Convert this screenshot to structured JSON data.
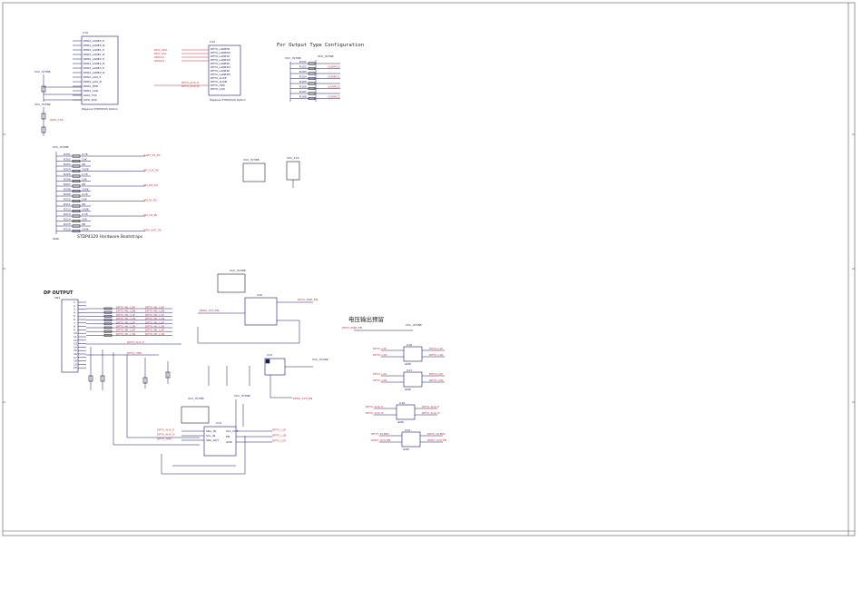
{
  "titles": {
    "config_heading": "For Output Type Configuration",
    "bootstraps": "STDP4320 Hardware Bootstraps",
    "dp_output": "DP   OUTPUT",
    "voltage_heading": "电压输出预留"
  },
  "parts": {
    "u_top_left": "Pegasus STDP4320 Option",
    "u_top_mid": "Pegasus STDP4320 Option",
    "u_dp_conn": "CN1",
    "u_ps": "U10",
    "u_sw": "U13",
    "u_ic1": "U16",
    "u_ic2": "U17",
    "u_ic3": "U18",
    "u_ic4": "U19"
  },
  "power": {
    "vcc33": "VCC_3V3SB",
    "gnd": "GND",
    "vcc12": "VCC_1V2"
  },
  "nets": {
    "left_pins": [
      "DPRX_LANE0_P",
      "DPRX_LANE0_N",
      "DPRX_LANE1_P",
      "DPRX_LANE1_N",
      "DPRX_LANE2_P",
      "DPRX_LANE2_N",
      "DPRX_LANE3_P",
      "DPRX_LANE3_N",
      "DPRX_AUX_P",
      "DPRX_AUX_N",
      "DPRX_HPD",
      "DPRX_CAD",
      "GPIO_TX0",
      "GPIO_RX0"
    ],
    "mid_left": [
      "DDC_SDA",
      "DDC_SCL",
      "GPIO11",
      "GPIO12"
    ],
    "mid_right": [
      "DPTX_LANE0P",
      "DPTX_LANE0N",
      "DPTX_LANE1P",
      "DPTX_LANE1N",
      "DPTX_LANE2P",
      "DPTX_LANE2N",
      "DPTX_LANE3P",
      "DPTX_LANE3N",
      "DPTX_AUXP",
      "DPTX_AUXN",
      "DPTX_HPD",
      "DPTX_CAD"
    ],
    "cfg_nets": [
      "CONFIG0",
      "CONFIG1",
      "CONFIG2",
      "CONFIG3"
    ],
    "boot_nets": [
      "UART_TX_P0",
      "SPI_CLK_P0",
      "SPI_DO_P0",
      "SPI_DI_P0",
      "SPI_CS_P0",
      "GPIO_EXT_P0"
    ],
    "dp_lanes": [
      "DPTX_ML_L0P",
      "DPTX_ML_L0N",
      "DPTX_ML_L1P",
      "DPTX_ML_L1N",
      "DPTX_ML_L2P",
      "DPTX_ML_L2N",
      "DPTX_ML_L3P",
      "DPTX_ML_L3N"
    ],
    "misc": [
      "DPTX_AUX_P",
      "DPTX_AUX_N",
      "DPTX_HPD",
      "DPTX_PWR_EN",
      "DPRX_3V3_EN"
    ],
    "sw_io": [
      "SDA_IN",
      "SCL_IN",
      "SDA_OUT",
      "SCL_OUT",
      "EN",
      "GND"
    ],
    "ic_labels": [
      "DPTX_L1P",
      "DPTX_L1N",
      "DPTX_L2P",
      "DPTX_L2N",
      "DPTX_3V3EN"
    ]
  },
  "resistors": {
    "cfg": [
      "R101",
      "R102",
      "R103",
      "R104",
      "R105",
      "R106",
      "R107",
      "R108"
    ],
    "boot": [
      "R201",
      "R202",
      "R203",
      "R204",
      "R205",
      "R206",
      "R207",
      "R208",
      "R209",
      "R210",
      "R211",
      "R212",
      "R213",
      "R214",
      "R215",
      "R216"
    ],
    "vals": [
      "4.7K",
      "10K",
      "0R",
      "100K"
    ]
  }
}
